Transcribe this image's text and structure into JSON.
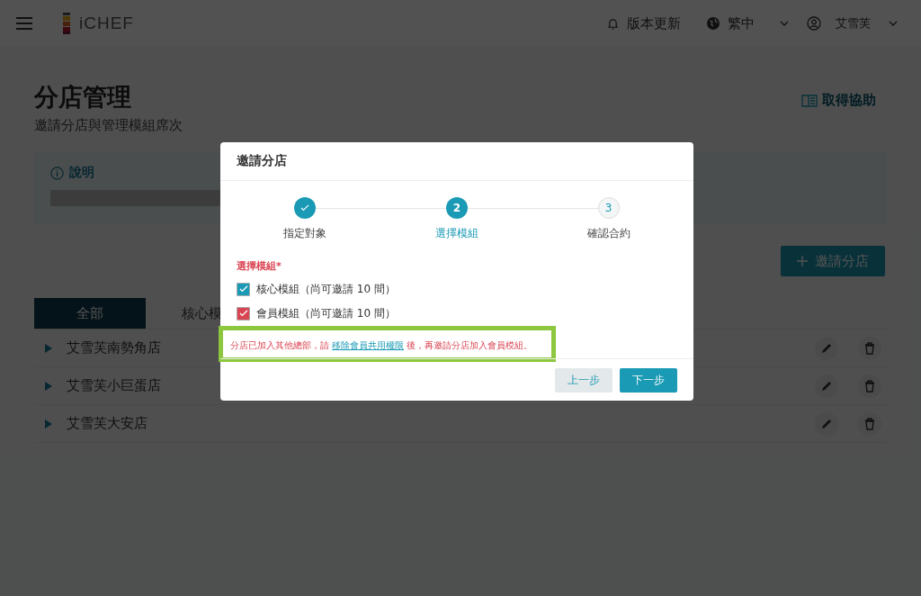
{
  "header": {
    "logo": "iCHEF",
    "update": "版本更新",
    "language": "繁中",
    "user": "艾雪芙"
  },
  "page": {
    "title": "分店管理",
    "subtitle": "邀請分店與管理模組席次",
    "help": "取得協助",
    "info_title": "說明",
    "invite_button": "邀請分店"
  },
  "tabs": [
    {
      "label": "全部",
      "selected": true
    },
    {
      "label": "核心模",
      "selected": false
    }
  ],
  "stores": [
    {
      "name": "艾雪芙南勢角店"
    },
    {
      "name": "艾雪芙小巨蛋店"
    },
    {
      "name": "艾雪芙大安店"
    }
  ],
  "dialog": {
    "title": "邀請分店",
    "steps": [
      {
        "label": "指定對象",
        "kind": "done"
      },
      {
        "label": "選擇模組",
        "kind": "current",
        "number": "2"
      },
      {
        "label": "確認合約",
        "kind": "upcoming",
        "number": "3"
      }
    ],
    "field_label": "選擇模組*",
    "modules": [
      {
        "label": "核心模組（尚可邀請 10 間）",
        "checked": true,
        "color": "#1a9ab5"
      },
      {
        "label": "會員模組（尚可邀請 10 間）",
        "checked": true,
        "color": "#d94452"
      }
    ],
    "error_before": "分店已加入其他總部，請",
    "error_link": "移除會員共用權限",
    "error_after": "後，再邀請分店加入會員模組。",
    "buttons": [
      {
        "label": "上一步",
        "kind": "secondary"
      },
      {
        "label": "下一步",
        "kind": "primary"
      }
    ]
  }
}
